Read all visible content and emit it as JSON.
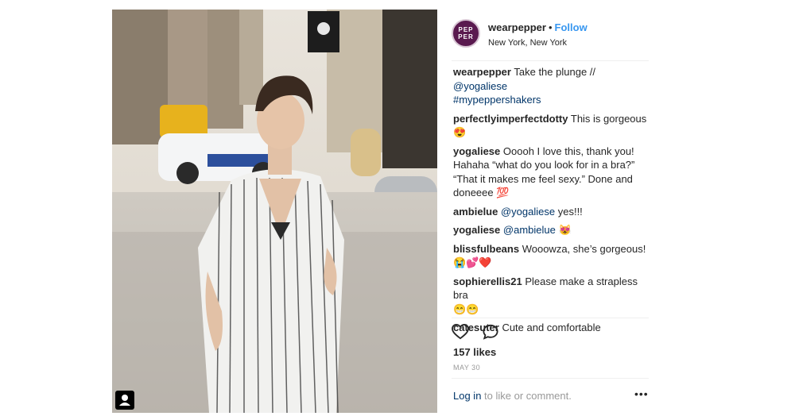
{
  "photo": {
    "alt": "",
    "badge_icon": "user-tag-icon"
  },
  "header": {
    "avatar_lines": [
      "PEP",
      "PER"
    ],
    "username": "wearpepper",
    "separator": "•",
    "follow_label": "Follow",
    "location": "New York, New York"
  },
  "caption": {
    "user": "wearpepper",
    "text": "Take the plunge // ",
    "mention": "@yogaliese",
    "hashtag": "#mypeppershakers"
  },
  "comments": [
    {
      "user": "perfectlyimperfectdotty",
      "text": "This is gorgeous",
      "emoji": "😍"
    },
    {
      "user": "yogaliese",
      "text": "Ooooh I love this, thank you! Hahaha “what do you look for in a bra?” “That it makes me feel sexy.” Done and doneeee",
      "emoji": "💯"
    },
    {
      "user": "ambielue",
      "mention": "@yogaliese",
      "text": " yes!!!"
    },
    {
      "user": "yogaliese",
      "mention": "@ambielue",
      "emoji": "😻"
    },
    {
      "user": "blissfulbeans",
      "text": "Wooowza, she’s gorgeous!",
      "emoji": "😭💕❤️"
    },
    {
      "user": "sophierellis21",
      "text": "Please make a strapless bra",
      "emoji": "😁😁"
    },
    {
      "user": "catesuter",
      "text": "Cute and comfortable"
    }
  ],
  "actions": {
    "like_icon": "heart-icon",
    "comment_icon": "comment-bubble-icon"
  },
  "likes": "157 likes",
  "date": "MAY 30",
  "footer": {
    "login_link": "Log in",
    "login_rest": " to like or comment.",
    "more": "•••"
  },
  "colors": {
    "link": "#3897f0",
    "mention": "#003569",
    "muted": "#999999"
  }
}
